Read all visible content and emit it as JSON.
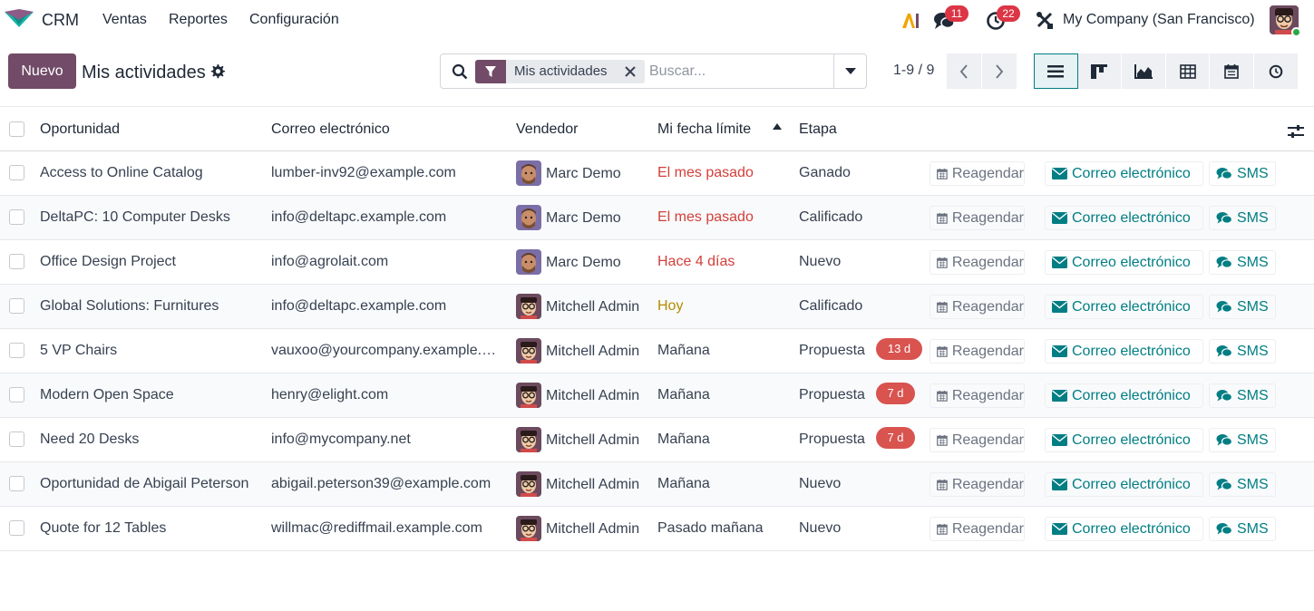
{
  "navbar": {
    "app_name": "CRM",
    "menu": [
      "Ventas",
      "Reportes",
      "Configuración"
    ],
    "messages_count": "11",
    "activities_count": "22",
    "company": "My Company (San Francisco)"
  },
  "control_panel": {
    "new_label": "Nuevo",
    "title": "Mis actividades",
    "facet_label": "Mis actividades",
    "search_placeholder": "Buscar...",
    "pager": "1-9 / 9"
  },
  "table": {
    "headers": {
      "opportunity": "Oportunidad",
      "email": "Correo electrónico",
      "salesperson": "Vendedor",
      "deadline": "Mi fecha límite",
      "stage": "Etapa"
    },
    "actions": {
      "reschedule": "Reagendar",
      "email": "Correo electrónico",
      "sms": "SMS"
    },
    "rows": [
      {
        "opportunity": "Access to Online Catalog",
        "email": "lumber-inv92@example.com",
        "salesperson": "Marc Demo",
        "deadline": "El mes pasado",
        "deadline_state": "overdue",
        "stage": "Ganado",
        "age": ""
      },
      {
        "opportunity": "DeltaPC: 10 Computer Desks",
        "email": "info@deltapc.example.com",
        "salesperson": "Marc Demo",
        "deadline": "El mes pasado",
        "deadline_state": "overdue",
        "stage": "Calificado",
        "age": ""
      },
      {
        "opportunity": "Office Design Project",
        "email": "info@agrolait.com",
        "salesperson": "Marc Demo",
        "deadline": "Hace 4 días",
        "deadline_state": "overdue",
        "stage": "Nuevo",
        "age": ""
      },
      {
        "opportunity": "Global Solutions: Furnitures",
        "email": "info@deltapc.example.com",
        "salesperson": "Mitchell Admin",
        "deadline": "Hoy",
        "deadline_state": "today",
        "stage": "Calificado",
        "age": ""
      },
      {
        "opportunity": "5 VP Chairs",
        "email": "vauxoo@yourcompany.example.com",
        "salesperson": "Mitchell Admin",
        "deadline": "Mañana",
        "deadline_state": "planned",
        "stage": "Propuesta",
        "age": "13 d"
      },
      {
        "opportunity": "Modern Open Space",
        "email": "henry@elight.com",
        "salesperson": "Mitchell Admin",
        "deadline": "Mañana",
        "deadline_state": "planned",
        "stage": "Propuesta",
        "age": "7 d"
      },
      {
        "opportunity": "Need 20 Desks",
        "email": "info@mycompany.net",
        "salesperson": "Mitchell Admin",
        "deadline": "Mañana",
        "deadline_state": "planned",
        "stage": "Propuesta",
        "age": "7 d"
      },
      {
        "opportunity": "Oportunidad de Abigail Peterson",
        "email": "abigail.peterson39@example.com",
        "salesperson": "Mitchell Admin",
        "deadline": "Mañana",
        "deadline_state": "planned",
        "stage": "Nuevo",
        "age": ""
      },
      {
        "opportunity": "Quote for 12 Tables",
        "email": "willmac@rediffmail.example.com",
        "salesperson": "Mitchell Admin",
        "deadline": "Pasado mañana",
        "deadline_state": "planned",
        "stage": "Nuevo",
        "age": ""
      }
    ]
  },
  "colors": {
    "brand": "#714b67",
    "accent": "#017e84",
    "overdue": "#d23f3a",
    "today": "#b28c00",
    "badge": "#dc3545"
  }
}
